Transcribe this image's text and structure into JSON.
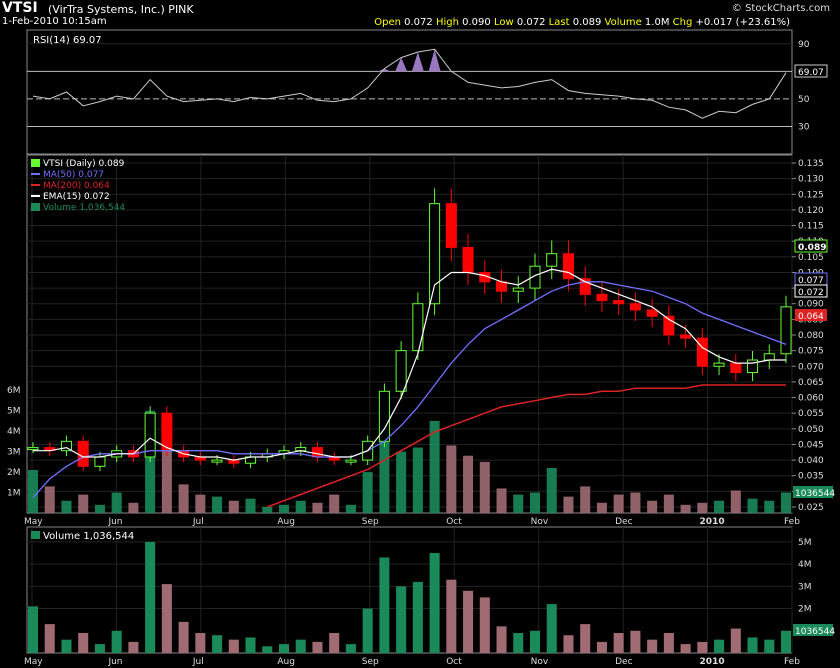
{
  "header": {
    "symbol": "VTSI",
    "company": "(VirTra Systems, Inc.) PINK",
    "datetime": "1-Feb-2010 10:15am",
    "brand": "© StockCharts.com",
    "quote": {
      "open_label": "Open",
      "open": "0.072",
      "high_label": "High",
      "high": "0.090",
      "low_label": "Low",
      "low": "0.072",
      "last_label": "Last",
      "last": "0.089",
      "volume_label": "Volume",
      "volume": "1.0M",
      "chg_label": "Chg",
      "chg": "+0.017 (+23.61%)"
    }
  },
  "rsi_panel": {
    "legend": "RSI(14) 69.07",
    "value_tag": "69.07",
    "levels": [
      30,
      50,
      70,
      90
    ]
  },
  "price_panel": {
    "legend_main": "VTSI (Daily) 0.089",
    "legend_ma50": "MA(50) 0.077",
    "legend_ma200": "MA(200) 0.064",
    "legend_ema15": "EMA(15) 0.072",
    "legend_volume": "Volume 1,036,544",
    "tag_last": "0.089",
    "tag_ma50": "0.077",
    "tag_ema": "0.072",
    "tag_ma200": "0.064",
    "tag_volume": "1036544"
  },
  "volume_panel": {
    "legend": "Volume 1,036,544",
    "tag_volume": "1036544"
  },
  "x_axis": {
    "labels": [
      "May",
      "Jun",
      "Jul",
      "Aug",
      "Sep",
      "Oct",
      "Nov",
      "Dec",
      "2010",
      "Feb"
    ]
  },
  "colors": {
    "up": "#66ff33",
    "down": "#ff0000",
    "ma50": "#7070ff",
    "ma200": "#dd2222",
    "ema15": "#ffffff",
    "rsi_fill": "#9a78c0",
    "vol_up": "#1a8a5a",
    "vol_down": "#a06b73"
  },
  "chart_data": {
    "type": "line",
    "title": "VTSI (Daily)",
    "x": [
      "May",
      "Jun",
      "Jul",
      "Aug",
      "Sep",
      "Oct",
      "Nov",
      "Dec",
      "2010",
      "Feb"
    ],
    "price_ylim": [
      0.025,
      0.135
    ],
    "price_ticks": [
      0.025,
      0.03,
      0.035,
      0.04,
      0.045,
      0.05,
      0.055,
      0.06,
      0.065,
      0.07,
      0.075,
      0.08,
      0.085,
      0.09,
      0.095,
      0.1,
      0.105,
      0.11,
      0.115,
      0.12,
      0.125,
      0.13,
      0.135
    ],
    "volume_ticks_left": [
      "1M",
      "2M",
      "3M",
      "4M",
      "5M",
      "6M"
    ],
    "volume_ticks_right": [
      "2M",
      "3M",
      "4M",
      "5M"
    ],
    "rsi_ylim": [
      10,
      100
    ],
    "series": [
      {
        "name": "VTSI (Daily)",
        "values": [
          0.044,
          0.043,
          0.046,
          0.038,
          0.041,
          0.043,
          0.041,
          0.055,
          0.043,
          0.041,
          0.04,
          0.04,
          0.039,
          0.041,
          0.042,
          0.043,
          0.044,
          0.041,
          0.04,
          0.04,
          0.046,
          0.062,
          0.075,
          0.09,
          0.122,
          0.108,
          0.1,
          0.097,
          0.094,
          0.095,
          0.102,
          0.106,
          0.098,
          0.093,
          0.091,
          0.09,
          0.088,
          0.086,
          0.08,
          0.079,
          0.07,
          0.071,
          0.068,
          0.072,
          0.074,
          0.089
        ]
      },
      {
        "name": "MA(50)",
        "values": [
          0.028,
          0.034,
          0.038,
          0.041,
          0.042,
          0.042,
          0.042,
          0.043,
          0.043,
          0.043,
          0.043,
          0.043,
          0.042,
          0.042,
          0.042,
          0.042,
          0.042,
          0.041,
          0.041,
          0.041,
          0.043,
          0.046,
          0.051,
          0.057,
          0.064,
          0.071,
          0.077,
          0.082,
          0.085,
          0.088,
          0.091,
          0.094,
          0.096,
          0.097,
          0.097,
          0.096,
          0.095,
          0.094,
          0.092,
          0.09,
          0.087,
          0.085,
          0.083,
          0.081,
          0.079,
          0.077
        ]
      },
      {
        "name": "MA(200)",
        "values": [
          0.0,
          0.0,
          0.0,
          0.0,
          0.0,
          0.0,
          0.0,
          0.0,
          0.0,
          0.0,
          0.0,
          0.0,
          0.0,
          0.0,
          0.025,
          0.027,
          0.029,
          0.031,
          0.033,
          0.035,
          0.037,
          0.04,
          0.043,
          0.046,
          0.049,
          0.051,
          0.053,
          0.055,
          0.057,
          0.058,
          0.059,
          0.06,
          0.061,
          0.061,
          0.062,
          0.062,
          0.063,
          0.063,
          0.063,
          0.063,
          0.064,
          0.064,
          0.064,
          0.064,
          0.064,
          0.064
        ]
      },
      {
        "name": "EMA(15)",
        "values": [
          0.043,
          0.043,
          0.044,
          0.041,
          0.041,
          0.042,
          0.042,
          0.047,
          0.044,
          0.042,
          0.041,
          0.041,
          0.04,
          0.041,
          0.041,
          0.042,
          0.043,
          0.042,
          0.041,
          0.041,
          0.043,
          0.05,
          0.06,
          0.074,
          0.096,
          0.1,
          0.1,
          0.099,
          0.097,
          0.096,
          0.099,
          0.101,
          0.1,
          0.097,
          0.095,
          0.093,
          0.091,
          0.089,
          0.085,
          0.082,
          0.076,
          0.073,
          0.071,
          0.071,
          0.072,
          0.072
        ]
      }
    ],
    "volume": [
      2.1,
      1.3,
      0.6,
      0.9,
      0.4,
      1.0,
      0.5,
      5.0,
      3.1,
      1.4,
      0.9,
      0.8,
      0.6,
      0.7,
      0.3,
      0.4,
      0.6,
      0.5,
      0.9,
      0.4,
      2.0,
      4.3,
      3.0,
      3.2,
      4.5,
      3.3,
      2.8,
      2.5,
      1.2,
      0.9,
      1.0,
      2.2,
      0.8,
      1.3,
      0.5,
      0.9,
      1.0,
      0.6,
      0.9,
      0.4,
      0.5,
      0.6,
      1.1,
      0.7,
      0.6,
      1.0
    ],
    "rsi": [
      52,
      50,
      55,
      45,
      48,
      52,
      50,
      64,
      52,
      48,
      49,
      50,
      48,
      51,
      50,
      52,
      54,
      49,
      48,
      50,
      58,
      72,
      80,
      84,
      86,
      70,
      62,
      60,
      58,
      59,
      62,
      64,
      56,
      54,
      53,
      52,
      50,
      49,
      44,
      42,
      36,
      41,
      40,
      46,
      50,
      69
    ]
  }
}
